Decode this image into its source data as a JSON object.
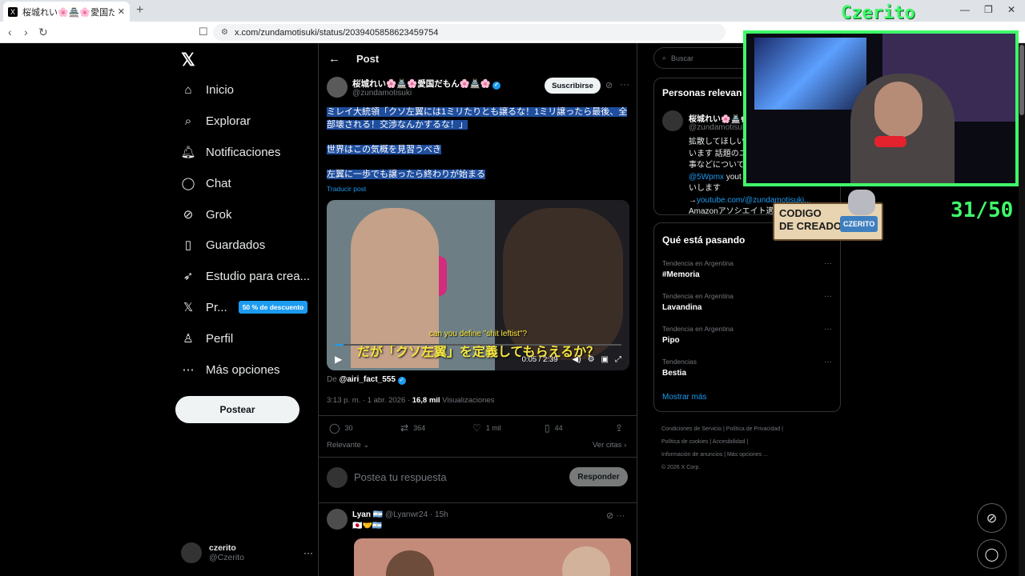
{
  "browser": {
    "tab_title": "桜城れい🌸🏯🌸愛国だもん🌸",
    "tab_close": "✕",
    "new_tab": "+",
    "url": "x.com/zundamotisuki/status/2039405858623459754"
  },
  "nav": {
    "items": [
      {
        "label": "Inicio",
        "icon": "home-icon"
      },
      {
        "label": "Explorar",
        "icon": "search-icon"
      },
      {
        "label": "Notificaciones",
        "icon": "bell-icon"
      },
      {
        "label": "Chat",
        "icon": "chat-icon"
      },
      {
        "label": "Grok",
        "icon": "grok-icon"
      },
      {
        "label": "Guardados",
        "icon": "bookmark-icon"
      },
      {
        "label": "Estudio para crea...",
        "icon": "rocket-icon"
      },
      {
        "label": "Pr...",
        "icon": "x-premium-icon"
      },
      {
        "label": "Perfil",
        "icon": "person-icon"
      },
      {
        "label": "Más opciones",
        "icon": "more-circle-icon"
      }
    ],
    "premium_badge": "50 % de descuento",
    "post_button": "Postear",
    "user": {
      "name": "czerito",
      "handle": "@Czerito"
    }
  },
  "main": {
    "header": "Post",
    "author": {
      "name": "桜城れい🌸🏯🌸愛国だもん🌸🏯🌸",
      "handle": "@zundamotisuki",
      "subscribe": "Suscribirse"
    },
    "text": {
      "p1": "ミレイ大統領「クソ左翼には1ミリたりとも譲るな！1ミリ譲ったら最後、全部壊される！交渉なんかするな！」",
      "p2": "世界はこの気概を見習うべき",
      "p3": "左翼に一歩でも譲ったら終わりが始まる"
    },
    "translate": "Traducir post",
    "video": {
      "subtitle_en": "can you define \"shit leftist\"?",
      "subtitle_jp": "だが「クソ左翼」を定義してもらえるか？",
      "time": "0:05 / 2:39",
      "progress": 0.03
    },
    "from_prefix": "De",
    "from_account": "@airi_fact_555",
    "timestamp": "3:13 p. m. · 1 abr. 2026 ·",
    "views_count": "16,8 mil",
    "views_label": "Visualizaciones",
    "actions": {
      "replies": "30",
      "reposts": "364",
      "likes": "1 mil",
      "bookmarks": "44"
    },
    "sort_label": "Relevante",
    "quotes_label": "Ver citas",
    "reply_placeholder": "Postea tu respuesta",
    "reply_button": "Responder",
    "reply": {
      "name": "Lyan 🇦🇷",
      "handle": "@Lyanwr24",
      "time": "15h",
      "text": "🇯🇵🤝🇦🇷"
    }
  },
  "right": {
    "search_placeholder": "Buscar",
    "people_title": "Personas relevan",
    "person": {
      "name": "桜城れい🌸🏯🌸",
      "handle": "@zundamotisuki",
      "bio_l1": "拡散してほしいニ",
      "bio_l2": "います 話題のニ",
      "bio_l3": "事などについて",
      "bio_l4_link": "@5Wpmx",
      "bio_l4_rest": " yout",
      "bio_l5": "いします",
      "bio_l6_link": "youtube.com/@zundamotisuki...",
      "bio_l6_prefix": "→",
      "bio_l7": "Amazonアソシエイト適当に作ってます"
    },
    "trends_title": "Qué está pasando",
    "trends": [
      {
        "category": "Tendencia en Argentina",
        "name": "#Memoria"
      },
      {
        "category": "Tendencia en Argentina",
        "name": "Lavandina"
      },
      {
        "category": "Tendencia en Argentina",
        "name": "Pipo"
      },
      {
        "category": "Tendencias",
        "name": "Bestia"
      }
    ],
    "show_more": "Mostrar más",
    "footer": {
      "l1": "Condiciones de Servicio  |  Política de Privacidad  |",
      "l2": "Política de cookies  |  Accesibilidad  |",
      "l3": "Información de anuncios  |  Más opciones ...",
      "l4": "© 2026 X Corp."
    }
  },
  "overlay": {
    "streamer_name": "Czerito",
    "counter": "31/50",
    "code_line1": "CODIGO",
    "code_line2": "DE CREADOR",
    "code_tag": "CZERITO",
    "border_color": "#40f96a"
  }
}
